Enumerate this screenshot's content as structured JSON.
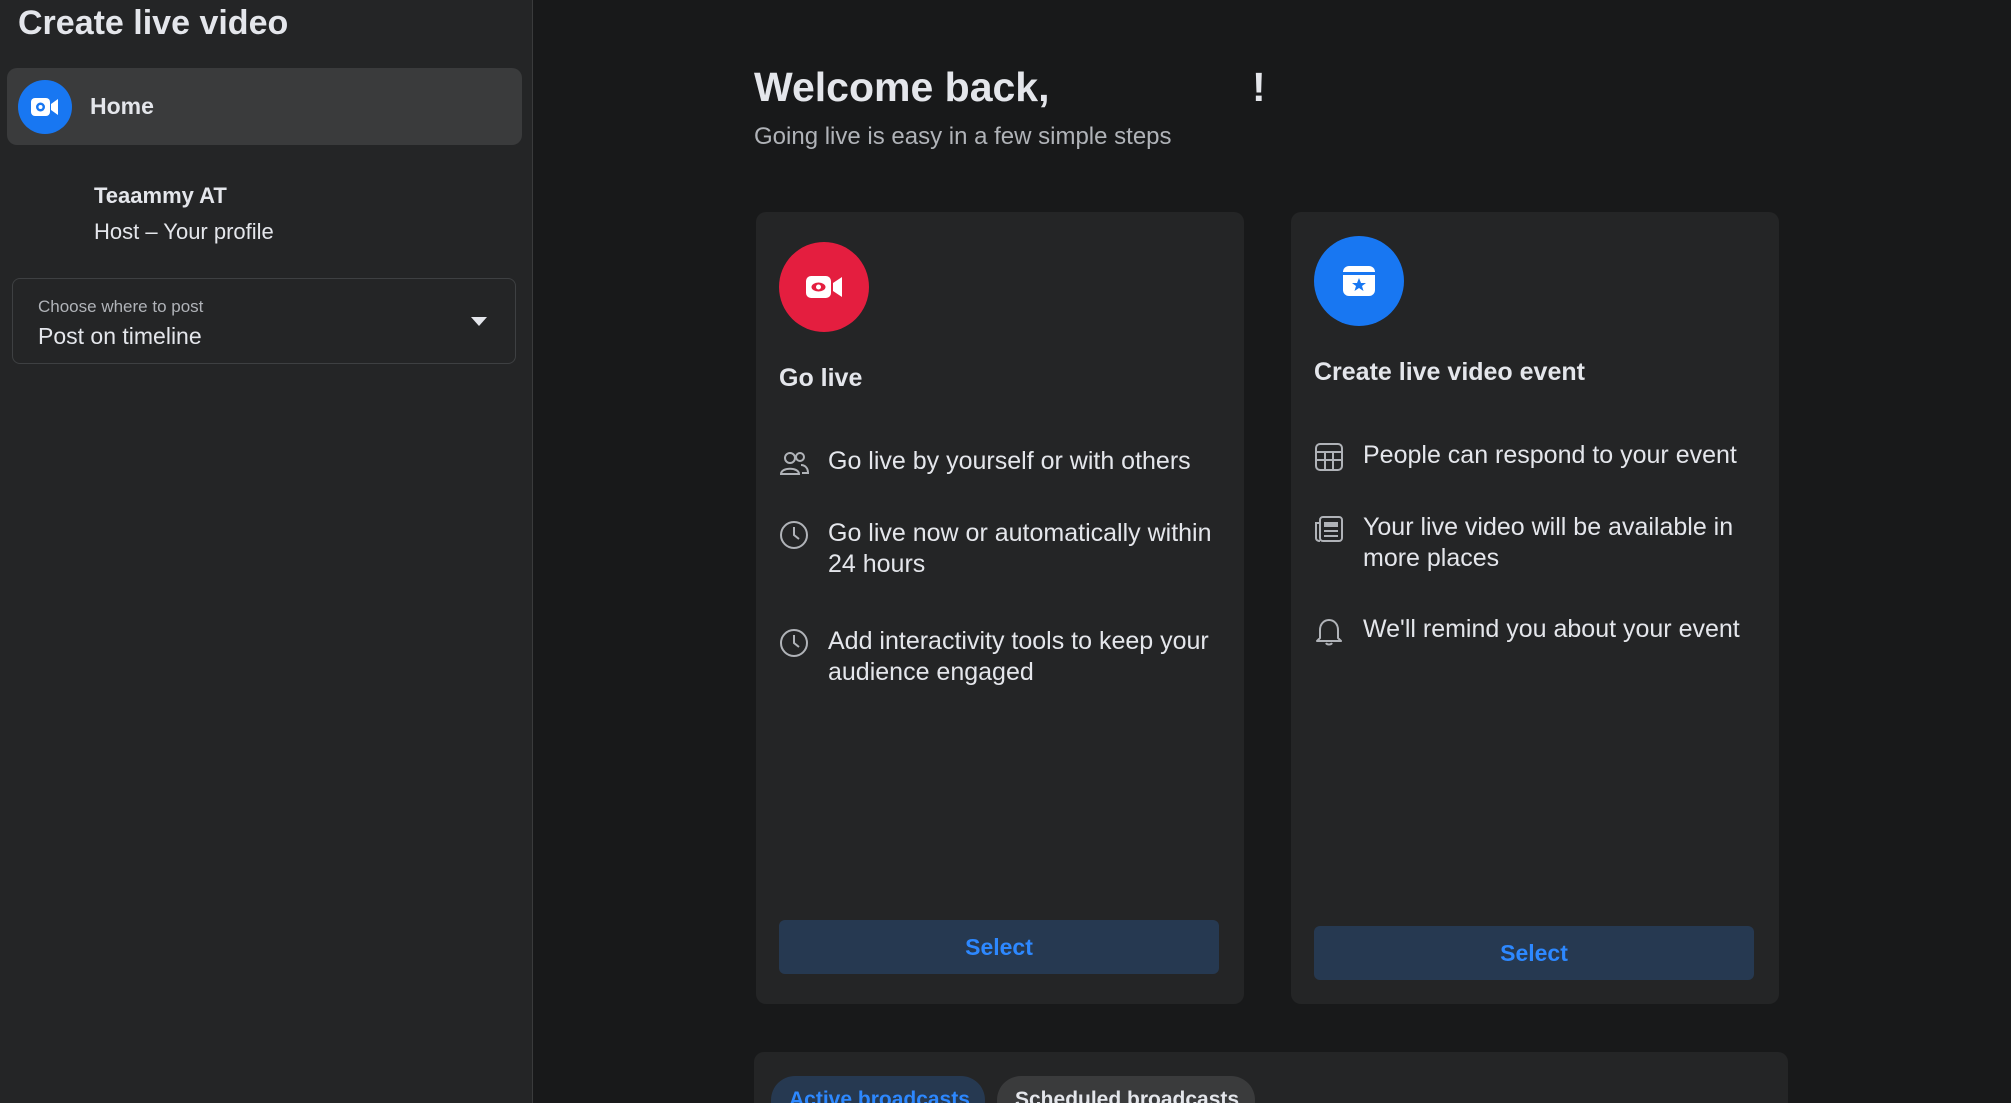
{
  "sidebar": {
    "title": "Create live video",
    "home_label": "Home",
    "profile_name": "Teaammy AT",
    "profile_role": "Host – Your profile",
    "post_select": {
      "caption": "Choose where to post",
      "value": "Post on timeline"
    }
  },
  "main": {
    "welcome": "Welcome back,",
    "welcome_end": "!",
    "subtitle": "Going live is easy in a few simple steps",
    "cards": [
      {
        "title": "Go live",
        "icon": "video-camera-icon",
        "icon_color": "#e41e3f",
        "features": [
          {
            "icon": "people-icon",
            "text": "Go live by yourself or with others"
          },
          {
            "icon": "clock-icon",
            "text": "Go live now or automatically within 24 hours"
          },
          {
            "icon": "clock-icon",
            "text": "Add interactivity tools to keep your audience engaged"
          }
        ],
        "button": "Select"
      },
      {
        "title": "Create live video event",
        "icon": "calendar-star-icon",
        "icon_color": "#1877f2",
        "features": [
          {
            "icon": "calendar-grid-icon",
            "text": "People can respond to your event"
          },
          {
            "icon": "newspaper-icon",
            "text": "Your live video will be available in more places"
          },
          {
            "icon": "bell-icon",
            "text": "We'll remind you about your event"
          }
        ],
        "button": "Select"
      }
    ],
    "tabs": [
      {
        "label": "Active broadcasts",
        "active": true
      },
      {
        "label": "Scheduled broadcasts",
        "active": false
      }
    ]
  },
  "colors": {
    "background": "#18191a",
    "surface": "#242526",
    "accent": "#2d88ff",
    "brand_blue": "#1877f2",
    "live_red": "#e41e3f"
  }
}
